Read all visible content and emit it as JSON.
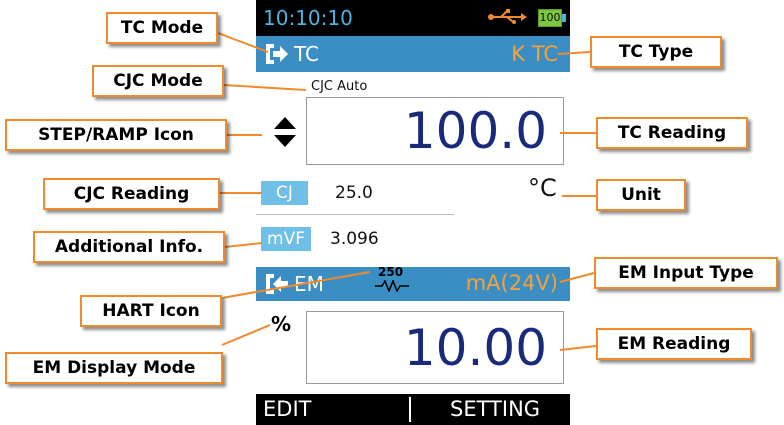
{
  "device": {
    "status_bar": {
      "time": "10:10:10",
      "battery": "100"
    },
    "tc_bar": {
      "icon": "tc-mode-arrow-icon",
      "mode": "TC",
      "type": "K TC"
    },
    "cjc_mode": "CJC Auto",
    "step_ramp_icon": "up-down-arrows-icon",
    "tc_reading": "100.0",
    "cjc": {
      "label": "CJ",
      "value": "25.0"
    },
    "unit": "°C",
    "additional": {
      "label": "mVF",
      "value": "3.096"
    },
    "em_bar": {
      "icon": "em-mode-arrow-icon",
      "mode": "EM",
      "hart_value": "250",
      "input_type": "mA(24V)"
    },
    "em_display_mode": "%",
    "em_reading": "10.00",
    "softkeys": {
      "left": "EDIT",
      "right": "SETTING"
    }
  },
  "callouts": {
    "tc_mode": "TC Mode",
    "cjc_mode": "CJC Mode",
    "step_ramp": "STEP/RAMP Icon",
    "cjc_reading": "CJC Reading",
    "additional_info": "Additional Info.",
    "hart_icon": "HART Icon",
    "em_display_mode": "EM Display Mode",
    "tc_type": "TC Type",
    "tc_reading": "TC Reading",
    "unit": "Unit",
    "em_input_type": "EM Input Type",
    "em_reading": "EM Reading"
  },
  "colors": {
    "accent_bar": "#3a8ec4",
    "type_text": "#f5a23a",
    "reading_text": "#1a2a7a",
    "chip": "#6fbfe6",
    "callout_border": "#f08a2c"
  }
}
